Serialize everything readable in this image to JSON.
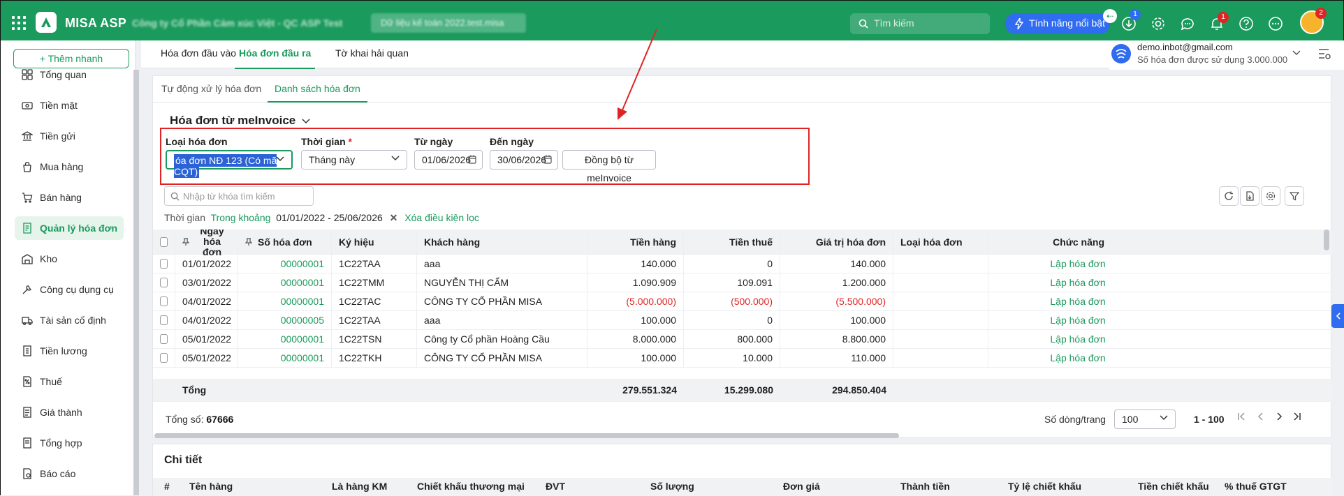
{
  "app": {
    "name": "MISA ASP",
    "company": "Công ty Cổ Phần Cảm xúc Việt - QC ASP Test",
    "database": "Dữ liệu kế toán 2022.test.misa"
  },
  "topbar": {
    "search_placeholder": "Tìm kiếm",
    "feature_btn": "Tính năng nổi bật",
    "download_badge": "1",
    "notif_badge": "1",
    "avatar_badge": "2",
    "back_glyph": "⇠"
  },
  "sidebar": {
    "add_button": "+ Thêm nhanh",
    "items": [
      {
        "label": "Tổng quan",
        "icon": "dashboard-icon"
      },
      {
        "label": "Tiền mặt",
        "icon": "cash-icon"
      },
      {
        "label": "Tiền gửi",
        "icon": "bank-icon"
      },
      {
        "label": "Mua hàng",
        "icon": "shopping-bag-icon"
      },
      {
        "label": "Bán hàng",
        "icon": "cart-icon"
      },
      {
        "label": "Quản lý hóa đơn",
        "icon": "invoice-icon",
        "active": true
      },
      {
        "label": "Kho",
        "icon": "warehouse-icon"
      },
      {
        "label": "Công cụ dụng cụ",
        "icon": "tools-icon"
      },
      {
        "label": "Tài sản cố định",
        "icon": "truck-icon"
      },
      {
        "label": "Tiền lương",
        "icon": "payroll-icon"
      },
      {
        "label": "Thuế",
        "icon": "tax-icon"
      },
      {
        "label": "Giá thành",
        "icon": "cost-icon"
      },
      {
        "label": "Tổng hợp",
        "icon": "summary-icon"
      },
      {
        "label": "Báo cáo",
        "icon": "report-icon"
      }
    ]
  },
  "tabs": [
    "Hóa đơn đầu vào",
    "Hóa đơn đầu ra",
    "Tờ khai hải quan"
  ],
  "user": {
    "email": "demo.inbot@gmail.com",
    "quota": "Số hóa đơn được sử dụng 3.000.000"
  },
  "subtabs": [
    "Tự động xử lý hóa đơn",
    "Danh sách hóa đơn"
  ],
  "section_title": "Hóa đơn từ meInvoice",
  "filters": {
    "invoice_type_label": "Loại hóa đơn",
    "invoice_type_value": "óa đơn NĐ 123 (Có mã CQT)",
    "period_label": "Thời gian",
    "required_mark": "*",
    "period_value": "Tháng này",
    "from_label": "Từ ngày",
    "from_value": "01/06/2026",
    "to_label": "Đến ngày",
    "to_value": "30/06/2026",
    "sync_button": "Đồng bộ từ meInvoice"
  },
  "keyword_placeholder": "Nhập từ khóa tìm kiếm",
  "chips": {
    "label": "Thời gian",
    "mode": "Trong khoảng",
    "range": "01/01/2022 - 25/06/2026",
    "clear": "Xóa điều kiện lọc",
    "remove_glyph": "✕"
  },
  "table": {
    "headers": {
      "date": "Ngày hóa đơn",
      "number": "Số hóa đơn",
      "symbol": "Ký hiệu",
      "customer": "Khách hàng",
      "goods": "Tiền hàng",
      "tax": "Tiền thuế",
      "total": "Giá trị hóa đơn",
      "type": "Loại hóa đơn",
      "action": "Chức năng"
    },
    "rows": [
      {
        "date": "01/01/2022",
        "number": "00000001",
        "symbol": "1C22TAA",
        "customer": "aaa",
        "goods": "140.000",
        "tax": "0",
        "total": "140.000",
        "type": "",
        "action": "Lập hóa đơn"
      },
      {
        "date": "03/01/2022",
        "number": "00000001",
        "symbol": "1C22TMM",
        "customer": "NGUYỄN THỊ CẨM",
        "goods": "1.090.909",
        "tax": "109.091",
        "total": "1.200.000",
        "type": "",
        "action": "Lập hóa đơn"
      },
      {
        "date": "04/01/2022",
        "number": "00000001",
        "symbol": "1C22TAC",
        "customer": "CÔNG TY CỔ PHẦN MISA",
        "goods": "(5.000.000)",
        "tax": "(500.000)",
        "total": "(5.500.000)",
        "type": "",
        "action": "Lập hóa đơn",
        "negative": true
      },
      {
        "date": "04/01/2022",
        "number": "00000005",
        "symbol": "1C22TAA",
        "customer": "aaa",
        "goods": "100.000",
        "tax": "0",
        "total": "100.000",
        "type": "",
        "action": "Lập hóa đơn"
      },
      {
        "date": "05/01/2022",
        "number": "00000001",
        "symbol": "1C22TSN",
        "customer": "Công ty Cổ phần Hoàng Cầu",
        "goods": "8.000.000",
        "tax": "800.000",
        "total": "8.800.000",
        "type": "",
        "action": "Lập hóa đơn"
      },
      {
        "date": "05/01/2022",
        "number": "00000001",
        "symbol": "1C22TKH",
        "customer": "CÔNG TY CỔ PHẦN MISA",
        "goods": "100.000",
        "tax": "10.000",
        "total": "110.000",
        "type": "",
        "action": "Lập hóa đơn"
      }
    ],
    "totals": {
      "label": "Tổng",
      "goods": "279.551.324",
      "tax": "15.299.080",
      "total": "294.850.404"
    }
  },
  "footer": {
    "count_label": "Tổng số:",
    "count": "67666",
    "page_size_label": "Số dòng/trang",
    "page_size": "100",
    "range": "1 - 100"
  },
  "detail": {
    "title": "Chi tiết",
    "headers": [
      "#",
      "Tên hàng",
      "Là hàng KM",
      "Chiết khấu thương mại",
      "ĐVT",
      "Số lượng",
      "Đơn giá",
      "Thành tiền",
      "Tỷ lệ chiết khấu",
      "Tiền chiết khấu",
      "% thuế GTGT"
    ]
  },
  "colors": {
    "brand": "#1a9a5c",
    "accent": "#2f6cf0",
    "alert": "#e02424"
  }
}
